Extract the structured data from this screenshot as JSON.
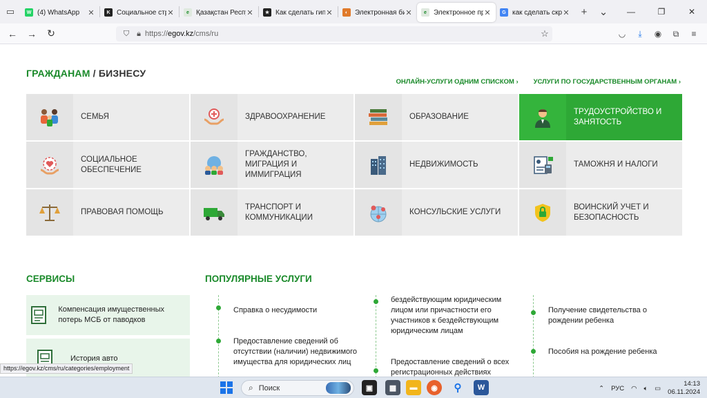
{
  "browser": {
    "tabs": [
      {
        "title": "(4) WhatsApp",
        "fav_color": "#25d366",
        "fav_glyph": "W"
      },
      {
        "title": "Социальное стр",
        "fav_color": "#222222",
        "fav_glyph": "K"
      },
      {
        "title": "Қазақстан Респуб",
        "fav_color": "#dfe9df",
        "fav_glyph": "e"
      },
      {
        "title": "Как сделать гипе",
        "fav_color": "#222222",
        "fav_glyph": "★"
      },
      {
        "title": "Электронная биб",
        "fav_color": "#e07a2a",
        "fav_glyph": "◐"
      },
      {
        "title": "Электронное пра",
        "fav_color": "#dfe9df",
        "fav_glyph": "e",
        "active": true
      },
      {
        "title": "как сделать скри",
        "fav_color": "#4285f4",
        "fav_glyph": "G"
      }
    ],
    "url_proto": "https://",
    "url_host": "egov.kz",
    "url_path": "/cms/ru"
  },
  "page": {
    "heading_citizens": "ГРАЖДАНАМ",
    "heading_sep": "/",
    "heading_business": "БИЗНЕСУ",
    "link_online": "ОНЛАЙН-УСЛУГИ ОДНИМ СПИСКОМ ›",
    "link_agencies": "УСЛУГИ ПО ГОСУДАРСТВЕННЫМ ОРГАНАМ ›",
    "categories": [
      {
        "label": "СЕМЬЯ",
        "icon": "family-icon"
      },
      {
        "label": "ЗДРАВООХРАНЕНИЕ",
        "icon": "healthcare-icon"
      },
      {
        "label": "ОБРАЗОВАНИЕ",
        "icon": "books-icon"
      },
      {
        "label": "ТРУДОУСТРОЙСТВО И ЗАНЯТОСТЬ",
        "icon": "employee-icon",
        "active": true
      },
      {
        "label": "СОЦИАЛЬНОЕ ОБЕСПЕЧЕНИЕ",
        "icon": "social-care-icon"
      },
      {
        "label": "ГРАЖДАНСТВО, МИГРАЦИЯ И ИММИГРАЦИЯ",
        "icon": "migration-icon"
      },
      {
        "label": "НЕДВИЖИМОСТЬ",
        "icon": "buildings-icon"
      },
      {
        "label": "ТАМОЖНЯ И НАЛОГИ",
        "icon": "tax-document-icon"
      },
      {
        "label": "ПРАВОВАЯ ПОМОЩЬ",
        "icon": "scales-icon"
      },
      {
        "label": "ТРАНСПОРТ И КОММУНИКАЦИИ",
        "icon": "truck-icon"
      },
      {
        "label": "КОНСУЛЬСКИЕ УСЛУГИ",
        "icon": "globe-pin-icon"
      },
      {
        "label": "ВОИНСКИЙ УЧЕТ И БЕЗОПАСНОСТЬ",
        "icon": "shield-lock-icon"
      }
    ],
    "services_title": "СЕРВИСЫ",
    "services": [
      {
        "label": "Компенсация имущественных потерь МСБ от паводков"
      },
      {
        "label": "История авто"
      }
    ],
    "popular_title": "ПОПУЛЯРНЫЕ УСЛУГИ",
    "popular_col1": [
      "Справка о несудимости",
      "Предоставление сведений об отсутствии (наличии) недвижимого имущества для юридических лиц"
    ],
    "popular_col2": [
      "бездействующим юридическим лицом или причастности его участников к бездействующим юридическим лицам",
      "Предоставление сведений о всех регистрационных действиях"
    ],
    "popular_col3": [
      "Получение свидетельства о рождении ребенка",
      "Пособия на рождение ребенка"
    ],
    "status_url": "https://egov.kz/cms/ru/categories/employment"
  },
  "taskbar": {
    "search_placeholder": "Поиск",
    "lang": "РУС",
    "time": "14:13",
    "date": "06.11.2024"
  },
  "colors": {
    "accent_green": "#2ea836",
    "heading_green": "#1a8a2a"
  }
}
